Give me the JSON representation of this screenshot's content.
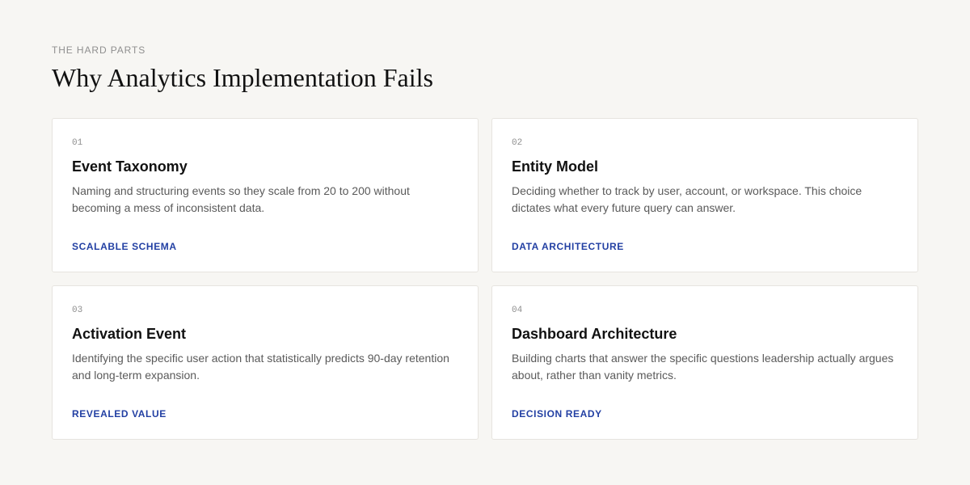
{
  "section": {
    "eyebrow": "THE HARD PARTS",
    "title": "Why Analytics Implementation Fails"
  },
  "cards": [
    {
      "number": "01",
      "title": "Event Taxonomy",
      "description": "Naming and structuring events so they scale from 20 to 200 without becoming a mess of inconsistent data.",
      "tag": "SCALABLE SCHEMA"
    },
    {
      "number": "02",
      "title": "Entity Model",
      "description": "Deciding whether to track by user, account, or workspace. This choice dictates what every future query can answer.",
      "tag": "DATA ARCHITECTURE"
    },
    {
      "number": "03",
      "title": "Activation Event",
      "description": "Identifying the specific user action that statistically predicts 90-day retention and long-term expansion.",
      "tag": "REVEALED VALUE"
    },
    {
      "number": "04",
      "title": "Dashboard Architecture",
      "description": "Building charts that answer the specific questions leadership actually argues about, rather than vanity metrics.",
      "tag": "DECISION READY"
    }
  ],
  "colors": {
    "background": "#f7f6f3",
    "card_background": "#ffffff",
    "card_border": "#e6e4df",
    "accent": "#2340a3",
    "heading": "#111111",
    "body_text": "#5a5a5a",
    "muted": "#8f8f8f"
  }
}
